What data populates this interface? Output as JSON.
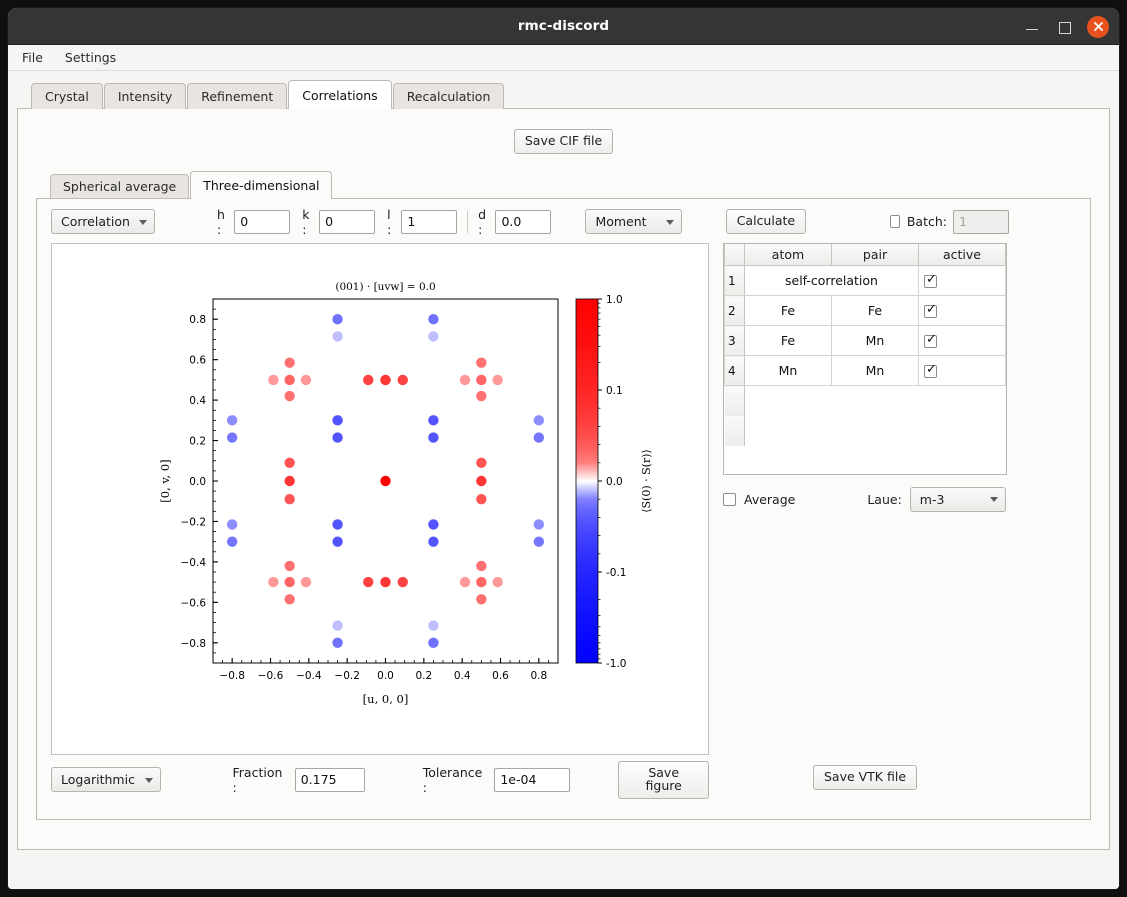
{
  "window": {
    "title": "rmc-discord",
    "controls": {
      "minimize": "minimize",
      "maximize": "maximize",
      "close": "close"
    }
  },
  "menubar": {
    "items": [
      {
        "label": "File"
      },
      {
        "label": "Settings"
      }
    ]
  },
  "main_tabs": {
    "items": [
      {
        "label": "Crystal",
        "active": false
      },
      {
        "label": "Intensity",
        "active": false
      },
      {
        "label": "Refinement",
        "active": false
      },
      {
        "label": "Correlations",
        "active": true
      },
      {
        "label": "Recalculation",
        "active": false
      }
    ]
  },
  "save_cif_button": "Save CIF file",
  "sub_tabs": {
    "items": [
      {
        "label": "Spherical average",
        "active": false
      },
      {
        "label": "Three-dimensional",
        "active": true
      }
    ]
  },
  "controls": {
    "type_combo": "Correlation",
    "h_label": "h :",
    "h_value": "0",
    "k_label": "k :",
    "k_value": "0",
    "l_label": "l :",
    "l_value": "1",
    "d_label": "d :",
    "d_value": "0.0",
    "component_combo": "Moment",
    "calculate_button": "Calculate",
    "batch_label": "Batch:",
    "batch_value": "1",
    "batch_checked": false
  },
  "table": {
    "headers": [
      "",
      "atom",
      "pair",
      "active"
    ],
    "rows": [
      {
        "n": "1",
        "atom": "self-correlation",
        "pair": "",
        "active": true,
        "merged": true
      },
      {
        "n": "2",
        "atom": "Fe",
        "pair": "Fe",
        "active": true,
        "merged": false
      },
      {
        "n": "3",
        "atom": "Fe",
        "pair": "Mn",
        "active": true,
        "merged": false
      },
      {
        "n": "4",
        "atom": "Mn",
        "pair": "Mn",
        "active": true,
        "merged": false
      }
    ]
  },
  "average": {
    "label": "Average",
    "checked": false
  },
  "laue": {
    "label": "Laue:",
    "value": "m-3"
  },
  "bottom": {
    "scale_combo": "Logarithmic",
    "fraction_label": "Fraction :",
    "fraction_value": "0.175",
    "tolerance_label": "Tolerance :",
    "tolerance_value": "1e-04",
    "save_figure_button": "Save figure"
  },
  "save_vtk_button": "Save VTK file",
  "chart_data": {
    "type": "scatter",
    "title": "(001) · [uvw] = 0.0",
    "xlabel": "[u, 0, 0]",
    "ylabel": "[0, v, 0]",
    "xlim": [
      -0.9,
      0.9
    ],
    "ylim": [
      -0.9,
      0.9
    ],
    "xticks": [
      -0.8,
      -0.6,
      -0.4,
      -0.2,
      0.0,
      0.2,
      0.4,
      0.6,
      0.8
    ],
    "xticklabels": [
      "−0.8",
      "−0.6",
      "−0.4",
      "−0.2",
      "0.0",
      "0.2",
      "0.4",
      "0.6",
      "0.8"
    ],
    "yticks": [
      -0.8,
      -0.6,
      -0.4,
      -0.2,
      0.0,
      0.2,
      0.4,
      0.6,
      0.8
    ],
    "yticklabels": [
      "−0.8",
      "−0.6",
      "−0.4",
      "−0.2",
      "0.0",
      "0.2",
      "0.4",
      "0.6",
      "0.8"
    ],
    "grid": false,
    "colorbar": {
      "label": "⟨S(0) · S(r)⟩",
      "ticks": [
        -1.0,
        -0.1,
        0.0,
        0.1,
        1.0
      ],
      "ticklabels": [
        "-1.0",
        "-0.1",
        "0.0",
        "0.1",
        "1.0"
      ],
      "vmin": -1.0,
      "vmax": 1.0,
      "scale": "symlog",
      "cmap_low": "#0000ff",
      "cmap_mid": "#ffffff",
      "cmap_high": "#ff0000"
    },
    "points": [
      {
        "x": 0.0,
        "y": 0.0,
        "v": 1.0
      },
      {
        "x": -0.5,
        "y": 0.0,
        "v": 0.38
      },
      {
        "x": 0.5,
        "y": 0.0,
        "v": 0.38
      },
      {
        "x": -0.5,
        "y": 0.09,
        "v": 0.22
      },
      {
        "x": 0.5,
        "y": 0.09,
        "v": 0.22
      },
      {
        "x": -0.5,
        "y": -0.09,
        "v": 0.22
      },
      {
        "x": 0.5,
        "y": -0.09,
        "v": 0.22
      },
      {
        "x": 0.0,
        "y": 0.5,
        "v": 0.38
      },
      {
        "x": 0.0,
        "y": -0.5,
        "v": 0.38
      },
      {
        "x": 0.09,
        "y": 0.5,
        "v": 0.3
      },
      {
        "x": -0.09,
        "y": 0.5,
        "v": 0.3
      },
      {
        "x": 0.09,
        "y": -0.5,
        "v": 0.3
      },
      {
        "x": -0.09,
        "y": -0.5,
        "v": 0.3
      },
      {
        "x": -0.5,
        "y": 0.5,
        "v": 0.16
      },
      {
        "x": 0.5,
        "y": 0.5,
        "v": 0.16
      },
      {
        "x": -0.5,
        "y": -0.5,
        "v": 0.16
      },
      {
        "x": 0.5,
        "y": -0.5,
        "v": 0.16
      },
      {
        "x": -0.5,
        "y": 0.585,
        "v": 0.13
      },
      {
        "x": 0.5,
        "y": 0.585,
        "v": 0.13
      },
      {
        "x": -0.5,
        "y": -0.585,
        "v": 0.13
      },
      {
        "x": 0.5,
        "y": -0.585,
        "v": 0.13
      },
      {
        "x": -0.5,
        "y": 0.42,
        "v": 0.13
      },
      {
        "x": 0.5,
        "y": 0.42,
        "v": 0.13
      },
      {
        "x": -0.5,
        "y": -0.42,
        "v": 0.13
      },
      {
        "x": 0.5,
        "y": -0.42,
        "v": 0.13
      },
      {
        "x": -0.585,
        "y": 0.5,
        "v": 0.08
      },
      {
        "x": -0.415,
        "y": 0.5,
        "v": 0.08
      },
      {
        "x": 0.585,
        "y": 0.5,
        "v": 0.08
      },
      {
        "x": 0.415,
        "y": 0.5,
        "v": 0.08
      },
      {
        "x": -0.585,
        "y": -0.5,
        "v": 0.08
      },
      {
        "x": -0.415,
        "y": -0.5,
        "v": 0.08
      },
      {
        "x": 0.585,
        "y": -0.5,
        "v": 0.08
      },
      {
        "x": 0.415,
        "y": -0.5,
        "v": 0.08
      },
      {
        "x": -0.8,
        "y": 0.3,
        "v": -0.09
      },
      {
        "x": -0.8,
        "y": 0.215,
        "v": -0.12
      },
      {
        "x": -0.8,
        "y": -0.215,
        "v": -0.09
      },
      {
        "x": -0.8,
        "y": -0.3,
        "v": -0.12
      },
      {
        "x": 0.8,
        "y": 0.3,
        "v": -0.09
      },
      {
        "x": 0.8,
        "y": 0.215,
        "v": -0.12
      },
      {
        "x": 0.8,
        "y": -0.215,
        "v": -0.09
      },
      {
        "x": 0.8,
        "y": -0.3,
        "v": -0.12
      },
      {
        "x": -0.25,
        "y": 0.3,
        "v": -0.22
      },
      {
        "x": -0.25,
        "y": 0.215,
        "v": -0.22
      },
      {
        "x": -0.25,
        "y": -0.215,
        "v": -0.22
      },
      {
        "x": -0.25,
        "y": -0.3,
        "v": -0.22
      },
      {
        "x": 0.25,
        "y": 0.3,
        "v": -0.22
      },
      {
        "x": 0.25,
        "y": 0.215,
        "v": -0.22
      },
      {
        "x": 0.25,
        "y": -0.215,
        "v": -0.22
      },
      {
        "x": 0.25,
        "y": -0.3,
        "v": -0.22
      },
      {
        "x": -0.25,
        "y": 0.8,
        "v": -0.13
      },
      {
        "x": -0.25,
        "y": 0.715,
        "v": -0.05
      },
      {
        "x": -0.25,
        "y": -0.715,
        "v": -0.05
      },
      {
        "x": -0.25,
        "y": -0.8,
        "v": -0.13
      },
      {
        "x": 0.25,
        "y": 0.8,
        "v": -0.13
      },
      {
        "x": 0.25,
        "y": 0.715,
        "v": -0.05
      },
      {
        "x": 0.25,
        "y": -0.715,
        "v": -0.05
      },
      {
        "x": 0.25,
        "y": -0.8,
        "v": -0.13
      }
    ]
  }
}
